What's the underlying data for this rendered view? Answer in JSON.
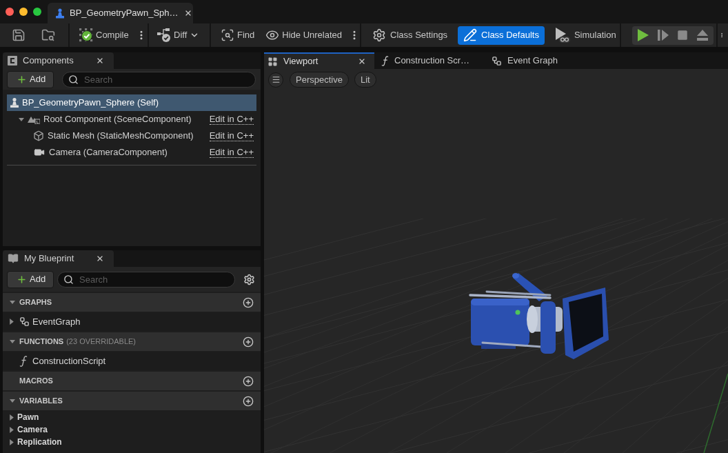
{
  "document_tab": {
    "title": "BP_GeometryPawn_Sph…"
  },
  "toolbar": {
    "actions": [
      {
        "kind": "compile",
        "label": "Compile",
        "more_menu": true
      },
      {
        "kind": "diff",
        "label": "Diff",
        "more_menu": false
      },
      {
        "kind": "find",
        "label": "Find",
        "more_menu": false
      },
      {
        "kind": "hide",
        "label": "Hide Unrelated",
        "more_menu": true
      }
    ],
    "modes": [
      {
        "kind": "settings",
        "label": "Class Settings",
        "selected": false
      },
      {
        "kind": "defaults",
        "label": "Class Defaults",
        "selected": true
      },
      {
        "kind": "simulation",
        "label": "Simulation",
        "selected": false
      }
    ],
    "play_controls": [
      {
        "kind": "play",
        "disabled": false
      },
      {
        "kind": "step",
        "disabled": true
      },
      {
        "kind": "stop",
        "disabled": true
      },
      {
        "kind": "eject",
        "disabled": true
      }
    ]
  },
  "components_panel": {
    "tab": {
      "title": "Components"
    },
    "add_button": {
      "label": "Add"
    },
    "search": {
      "placeholder": "Search"
    },
    "tree": [
      {
        "kind": "self",
        "label": "BP_GeometryPawn_Sphere (Self)",
        "selected": true,
        "children": [
          {
            "kind": "scene",
            "label": "Root Component (SceneComponent)",
            "link": "Edit in C++",
            "selected": false,
            "expanded": true,
            "children": [
              {
                "kind": "mesh",
                "label": "Static Mesh (StaticMeshComponent)",
                "link": "Edit in C++",
                "selected": false
              },
              {
                "kind": "camera",
                "label": "Camera (CameraComponent)",
                "link": "Edit in C++",
                "selected": false
              }
            ]
          }
        ]
      }
    ]
  },
  "my_blueprint_panel": {
    "tab": {
      "title": "My Blueprint"
    },
    "add_button": {
      "label": "Add"
    },
    "search": {
      "placeholder": "Search"
    },
    "sections": [
      {
        "title": "GRAPHS",
        "expanded": true,
        "items": [
          {
            "kind": "graph",
            "label": "EventGraph",
            "expanded": false
          }
        ]
      },
      {
        "title": "FUNCTIONS",
        "note": "(23 OVERRIDABLE)",
        "expanded": true,
        "items": [
          {
            "kind": "function",
            "label": "ConstructionScript"
          }
        ]
      },
      {
        "title": "MACROS"
      },
      {
        "title": "VARIABLES",
        "expanded": true,
        "items": [
          {
            "kind": "category",
            "label": "Pawn",
            "expanded": false
          },
          {
            "kind": "category",
            "label": "Camera",
            "expanded": false
          },
          {
            "kind": "category",
            "label": "Replication",
            "expanded": false
          }
        ]
      }
    ]
  },
  "editor_tabs": [
    {
      "kind": "viewport",
      "label": "Viewport",
      "selected": true
    },
    {
      "kind": "function",
      "label": "Construction Scr…",
      "selected": false
    },
    {
      "kind": "graph",
      "label": "Event Graph",
      "selected": false
    }
  ],
  "viewport": {
    "view_options": [
      "Perspective",
      "Lit"
    ]
  }
}
